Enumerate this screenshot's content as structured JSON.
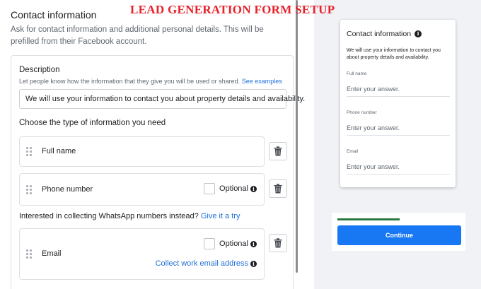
{
  "banner": "LEAD GENERATION FORM SETUP",
  "editor": {
    "title": "Contact information",
    "description": "Ask for contact information and additional personal details. This will be prefilled from their Facebook account.",
    "desc_label": "Description",
    "desc_help": "Let people know how the information that they give you will be used or shared.",
    "desc_help_link": "See examples",
    "desc_value": "We will use your information to contact you about property details and availability.",
    "choose_label": "Choose the type of information you need",
    "fields": [
      {
        "name": "Full name",
        "optional": false
      },
      {
        "name": "Phone number",
        "optional": true,
        "optional_label": "Optional"
      },
      {
        "name": "Email",
        "optional": true,
        "optional_label": "Optional",
        "extra_link": "Collect work email address"
      }
    ],
    "whatsapp_text": "Interested in collecting WhatsApp numbers instead?",
    "whatsapp_link": "Give it a try"
  },
  "preview": {
    "title": "Contact information",
    "description": "We will use your information to contact you about property details and availability.",
    "fields": [
      {
        "label": "Full name",
        "placeholder": "Enter your answer."
      },
      {
        "label": "Phone number",
        "placeholder": "Enter your answer."
      },
      {
        "label": "Email",
        "placeholder": "Enter your answer."
      }
    ],
    "progress": 0.45,
    "continue_label": "Continue"
  },
  "colors": {
    "banner": "#e8202a",
    "link": "#216fdb",
    "button": "#1877f2",
    "progress": "#2a7a3f"
  }
}
